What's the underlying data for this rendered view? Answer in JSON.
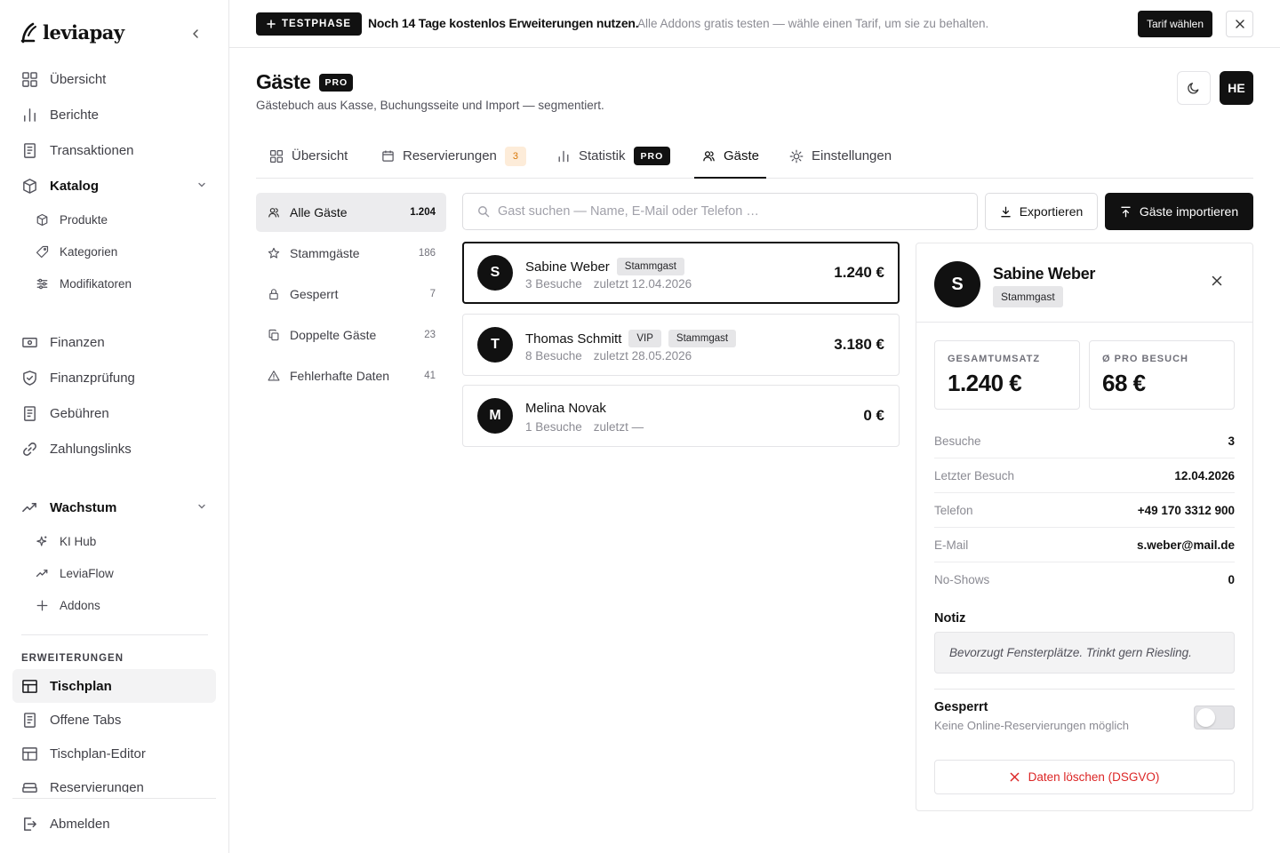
{
  "app": {
    "name": "leviapay"
  },
  "sidebar": {
    "items": [
      {
        "label": "Übersicht",
        "icon": "grid-icon"
      },
      {
        "label": "Berichte",
        "icon": "bar-chart-icon"
      },
      {
        "label": "Transaktionen",
        "icon": "receipt-icon"
      }
    ],
    "katalog": {
      "label": "Katalog",
      "items": [
        "Produkte",
        "Kategorien",
        "Modifikatoren"
      ]
    },
    "items2": [
      {
        "label": "Finanzen",
        "icon": "banknote-icon"
      },
      {
        "label": "Finanzprüfung",
        "icon": "shield-check-icon"
      },
      {
        "label": "Gebühren",
        "icon": "receipt-icon"
      },
      {
        "label": "Zahlungslinks",
        "icon": "link-icon"
      }
    ],
    "wachstum": {
      "label": "Wachstum",
      "items": [
        "KI Hub",
        "LeviaFlow",
        "Addons"
      ]
    },
    "section_label": "ERWEITERUNGEN",
    "erweiterungen": [
      "Tischplan",
      "Offene Tabs",
      "Tischplan-Editor",
      "Reservierungen"
    ],
    "logout": "Abmelden"
  },
  "banner": {
    "badge": "TESTPHASE",
    "main_pre": "Noch ",
    "main_days": "14 Tage",
    "main_post": " kostenlos Erweiterungen nutzen.",
    "sub": "Alle Addons gratis testen — wähle einen Tarif, um sie zu behalten.",
    "cta": "Tarif wählen"
  },
  "header": {
    "title": "Gäste",
    "badge": "PRO",
    "subtitle": "Gästebuch aus Kasse, Buchungsseite und Import — segmentiert.",
    "user_initials": "HE"
  },
  "tabs": [
    {
      "label": "Übersicht"
    },
    {
      "label": "Reservierungen",
      "badge": "3"
    },
    {
      "label": "Statistik",
      "badge": "PRO"
    },
    {
      "label": "Gäste",
      "active": true
    },
    {
      "label": "Einstellungen"
    }
  ],
  "filters": [
    {
      "label": "Alle Gäste",
      "count": "1.204",
      "active": true
    },
    {
      "label": "Stammgäste",
      "count": "186"
    },
    {
      "label": "Gesperrt",
      "count": "7"
    },
    {
      "label": "Doppelte Gäste",
      "count": "23"
    },
    {
      "label": "Fehlerhafte Daten",
      "count": "41"
    }
  ],
  "search": {
    "placeholder": "Gast suchen — Name, E-Mail oder Telefon …",
    "value": ""
  },
  "actions": {
    "export": "Exportieren",
    "import": "Gäste importieren"
  },
  "guests": [
    {
      "initial": "S",
      "name": "Sabine Weber",
      "tags": [
        "Stammgast"
      ],
      "visits": "3 Besuche",
      "last": "zuletzt 12.04.2026",
      "amount": "1.240 €",
      "selected": true
    },
    {
      "initial": "T",
      "name": "Thomas Schmitt",
      "tags": [
        "VIP",
        "Stammgast"
      ],
      "visits": "8 Besuche",
      "last": "zuletzt 28.05.2026",
      "amount": "3.180 €"
    },
    {
      "initial": "M",
      "name": "Melina Novak",
      "tags": [],
      "visits": "1 Besuche",
      "last": "zuletzt —",
      "amount": "0 €"
    }
  ],
  "detail": {
    "initial": "S",
    "name": "Sabine Weber",
    "tag": "Stammgast",
    "stats": [
      {
        "label": "GESAMTUMSATZ",
        "value": "1.240 €"
      },
      {
        "label": "Ø PRO BESUCH",
        "value": "68 €"
      }
    ],
    "rows": [
      {
        "key": "Besuche",
        "value": "3"
      },
      {
        "key": "Letzter Besuch",
        "value": "12.04.2026"
      },
      {
        "key": "Telefon",
        "value": "+49 170 3312 900"
      },
      {
        "key": "E-Mail",
        "value": "s.weber@mail.de"
      },
      {
        "key": "No-Shows",
        "value": "0"
      }
    ],
    "note_label": "Notiz",
    "note": "Bevorzugt Fensterplätze. Trinkt gern Riesling.",
    "blocked_label": "Gesperrt",
    "blocked_sub": "Keine Online-Reservierungen möglich",
    "blocked": false,
    "delete": "Daten löschen (DSGVO)",
    "delete_color": "#dc2626"
  }
}
